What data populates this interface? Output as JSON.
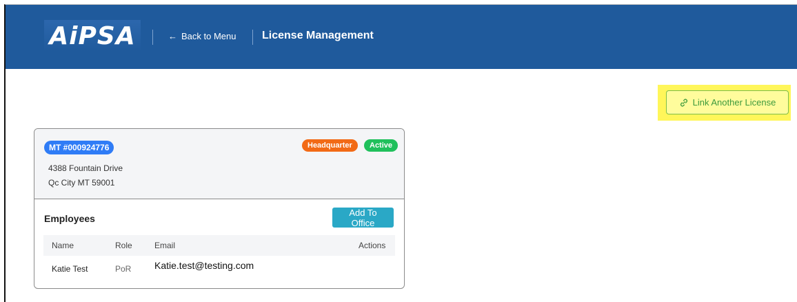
{
  "header": {
    "logo_text": "AiPSA",
    "back_link": "Back to Menu",
    "page_title": "License Management"
  },
  "toolbar": {
    "link_license_label": "Link Another License"
  },
  "license_card": {
    "license_number": "MT #000924776",
    "badges": [
      "Headquarter",
      "Active"
    ],
    "address_line1": "4388 Fountain Drive",
    "address_line2": "Qc City MT 59001",
    "employees_title": "Employees",
    "add_button": "Add To Office",
    "table": {
      "columns": [
        "Name",
        "Role",
        "Email",
        "Actions"
      ],
      "rows": [
        {
          "name": "Katie Test",
          "role": "PoR",
          "email": "Katie.test@testing.com"
        }
      ]
    }
  },
  "colors": {
    "header_bg": "#1f5a9c",
    "license_pill": "#2f7cf6",
    "headquarter_badge": "#f26a16",
    "active_badge": "#20c05c",
    "add_button": "#2aa8c6",
    "highlight": "#fff65a"
  }
}
